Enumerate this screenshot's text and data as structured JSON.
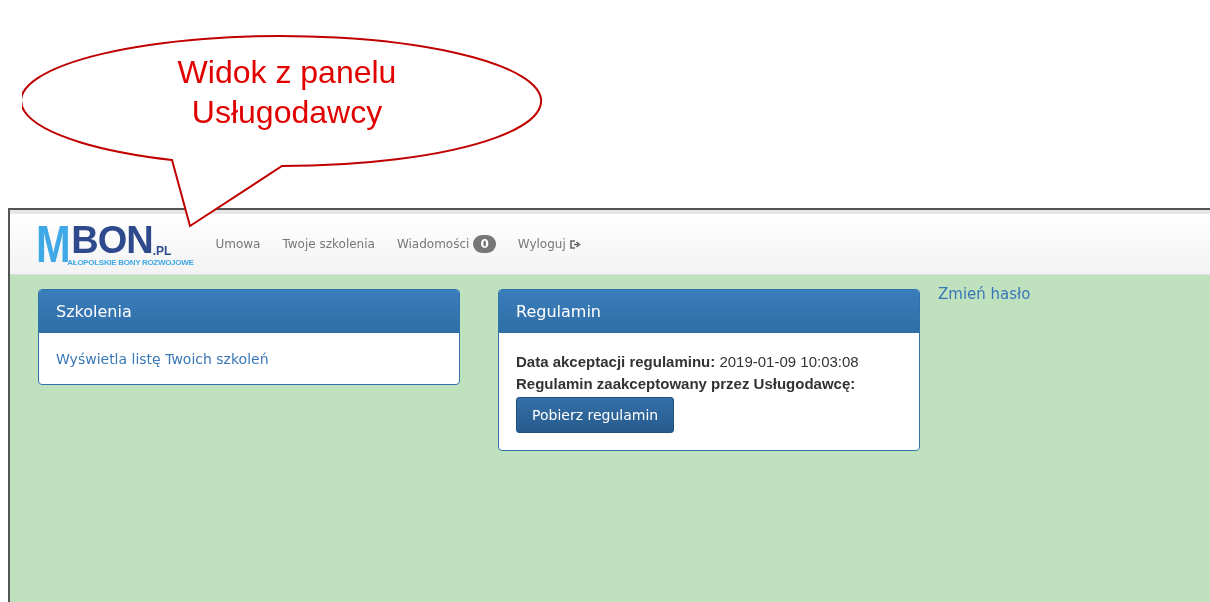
{
  "callout": {
    "lines": [
      "Widok z panelu",
      "Usługodawcy"
    ]
  },
  "logo": {
    "initial": "M",
    "word": "BON",
    "suffix": ".PL",
    "tagline": "AŁOPOLSKIE BONY ROZWOJOWE"
  },
  "nav": [
    {
      "label": "Umowa",
      "kind": "link"
    },
    {
      "label": "Twoje szkolenia",
      "kind": "link"
    },
    {
      "label": "Wiadomości",
      "kind": "badge",
      "count": "0"
    },
    {
      "label": "Wyloguj",
      "kind": "logout"
    }
  ],
  "panels": [
    {
      "title": "Szkolenia",
      "link": "Wyświetla listę Twoich szkoleń"
    },
    {
      "title": "Regulamin",
      "lines": [
        {
          "label": "Data akceptacji regulaminu:",
          "value": "2019-01-09 10:03:08"
        },
        {
          "label": "Regulamin zaakceptowany przez Usługodawcę:"
        }
      ],
      "button": "Pobierz regulamin"
    }
  ],
  "side_link": "Zmień hasło"
}
